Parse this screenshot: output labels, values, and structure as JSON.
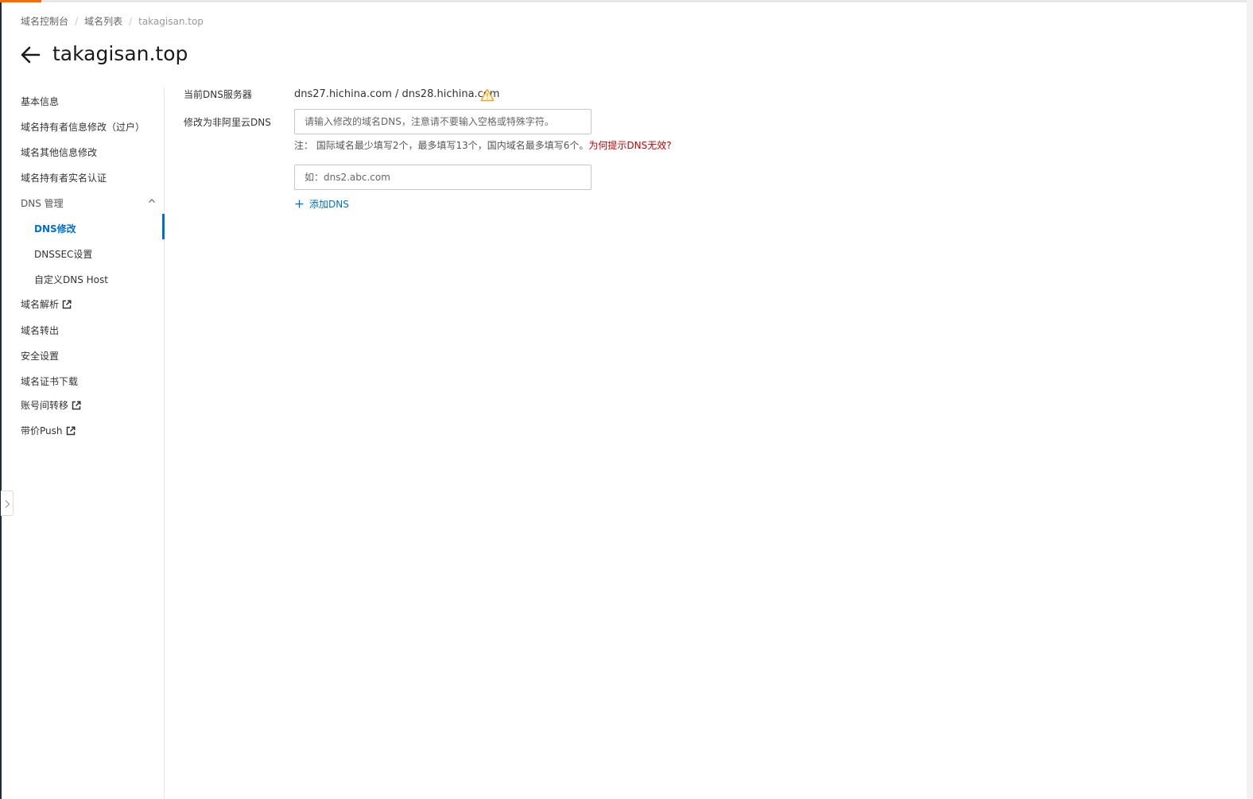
{
  "breadcrumb": {
    "items": [
      "域名控制台",
      "域名列表",
      "takagisan.top"
    ],
    "separator": "/"
  },
  "page": {
    "title": "takagisan.top"
  },
  "sidebar": {
    "items": [
      {
        "label": "基本信息"
      },
      {
        "label": "域名持有者信息修改（过户）"
      },
      {
        "label": "域名其他信息修改"
      },
      {
        "label": "域名持有者实名认证"
      },
      {
        "label": "DNS 管理",
        "expanded": true
      },
      {
        "label": "DNS修改",
        "active": true
      },
      {
        "label": "DNSSEC设置"
      },
      {
        "label": "自定义DNS Host"
      },
      {
        "label": "域名解析",
        "external": true
      },
      {
        "label": "域名转出"
      },
      {
        "label": "安全设置"
      },
      {
        "label": "域名证书下载"
      },
      {
        "label": "账号间转移",
        "external": true
      },
      {
        "label": "带价Push",
        "external": true
      }
    ]
  },
  "form": {
    "current_dns_label": "当前DNS服务器",
    "current_dns_value": "dns27.hichina.com / dns28.hichina.com",
    "change_dns_label": "修改为非阿里云DNS",
    "dns_input_1_placeholder": "请输入修改的域名DNS，注意请不要输入空格或特殊字符。",
    "dns_input_2_placeholder": "如：dns2.abc.com",
    "note_text": "注：  国际域名最少填写2个，最多填写13个，国内域名最多填写6个。",
    "note_link": "为何提示DNS无效?",
    "add_dns_label": "添加DNS"
  },
  "colors": {
    "accent_orange": "#ff6a00",
    "link_blue": "#0070cc",
    "warning_red": "#c80000",
    "warning_yellow": "#f5a623"
  },
  "icons": {
    "back": "arrow-left-icon",
    "warning": "warning-triangle-icon",
    "external": "external-link-icon",
    "chevron": "chevron-up-icon",
    "add": "plus-icon",
    "collapse": "chevron-right-icon"
  }
}
